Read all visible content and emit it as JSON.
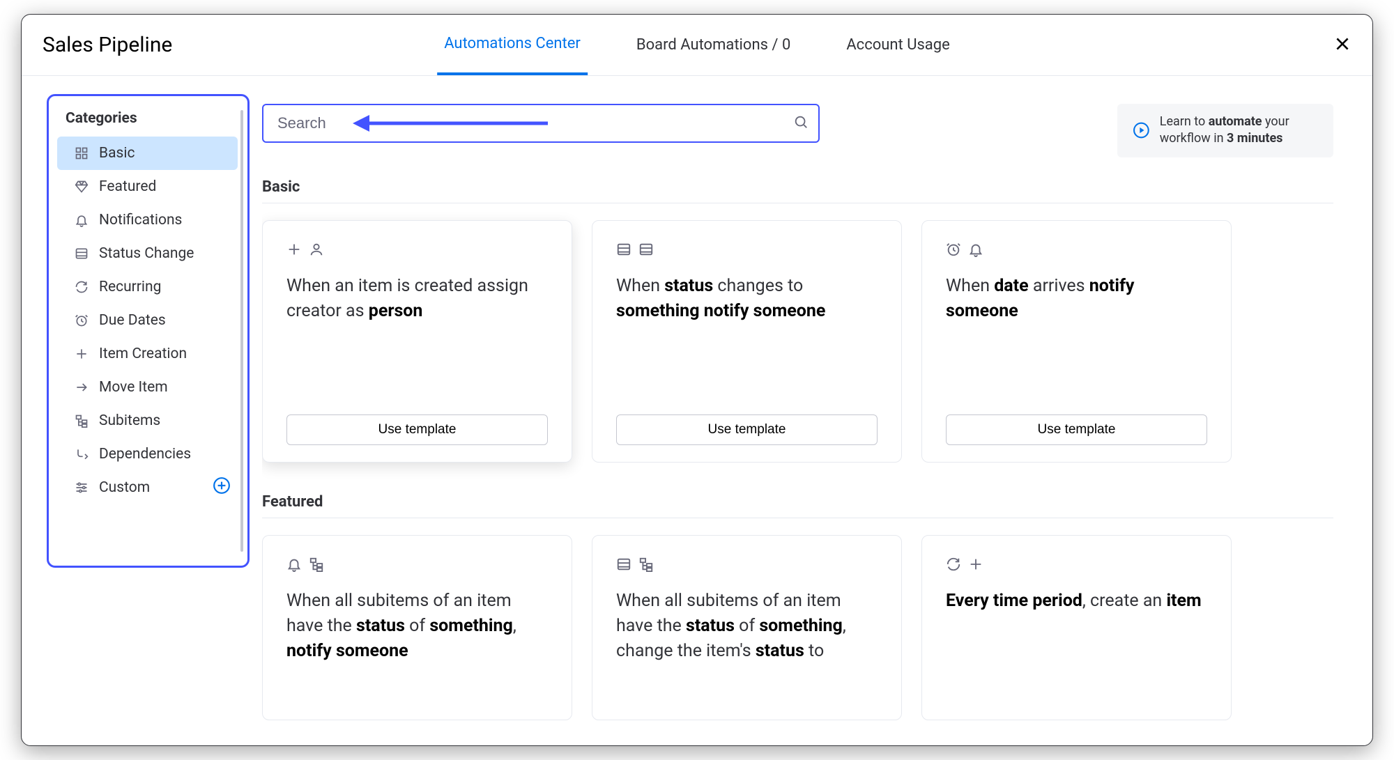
{
  "header": {
    "title": "Sales Pipeline",
    "tabs": [
      {
        "label": "Automations Center"
      },
      {
        "label": "Board Automations / 0"
      },
      {
        "label": "Account Usage"
      }
    ]
  },
  "sidebar": {
    "title": "Categories",
    "items": [
      {
        "label": "Basic"
      },
      {
        "label": "Featured"
      },
      {
        "label": "Notifications"
      },
      {
        "label": "Status Change"
      },
      {
        "label": "Recurring"
      },
      {
        "label": "Due Dates"
      },
      {
        "label": "Item Creation"
      },
      {
        "label": "Move Item"
      },
      {
        "label": "Subitems"
      },
      {
        "label": "Dependencies"
      },
      {
        "label": "Custom"
      }
    ]
  },
  "search": {
    "placeholder": "Search"
  },
  "learn": {
    "prefix": "Learn to ",
    "strong1": "automate",
    "mid": " your workflow in ",
    "strong2": "3 minutes"
  },
  "sections": {
    "basic": {
      "title": "Basic",
      "cards": [
        {
          "t1": "When an item is created assign creator as ",
          "b1": "person",
          "btn": "Use template"
        },
        {
          "t1": "When ",
          "b1": "status",
          "t2": " changes to ",
          "b2": "something",
          "t3": " ",
          "b3": "notify",
          "t4": " ",
          "b4": "someone",
          "btn": "Use template"
        },
        {
          "t1": "When ",
          "b1": "date",
          "t2": " arrives ",
          "b2": "notify",
          "t3": " ",
          "b3": "someone",
          "btn": "Use template"
        }
      ]
    },
    "featured": {
      "title": "Featured",
      "cards": [
        {
          "t1": "When all subitems of an item have the ",
          "b1": "status",
          "t2": " of ",
          "b2": "something",
          "t3": ", ",
          "b3": "notify someone"
        },
        {
          "t1": "When all subitems of an item have the ",
          "b1": "status",
          "t2": " of ",
          "b2": "something",
          "t3": ", change the item's ",
          "b3": "status",
          "t4": " to"
        },
        {
          "b1": "Every time period",
          "t2": ", create an ",
          "b2": "item"
        }
      ]
    }
  }
}
